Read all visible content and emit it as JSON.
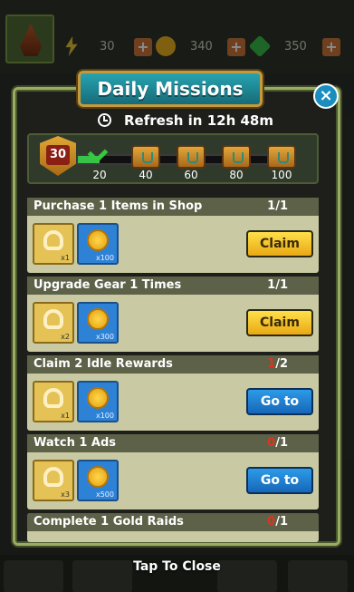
{
  "hud": {
    "energy": "30",
    "coins": "340",
    "gems": "350"
  },
  "modal": {
    "title": "Daily Missions",
    "refresh": "Refresh in 12h 48m",
    "level": "30",
    "progress_fraction": 0.1,
    "milestones": [
      "20",
      "40",
      "60",
      "80",
      "100"
    ]
  },
  "missions": [
    {
      "title": "Purchase 1 Items in Shop",
      "current": "1",
      "total": "/1",
      "current_red": false,
      "scroll_qty": "x1",
      "coin_qty": "x100",
      "action": "Claim",
      "action_type": "claim"
    },
    {
      "title": "Upgrade Gear 1 Times",
      "current": "1",
      "total": "/1",
      "current_red": false,
      "scroll_qty": "x2",
      "coin_qty": "x300",
      "action": "Claim",
      "action_type": "claim"
    },
    {
      "title": "Claim 2 Idle Rewards",
      "current": "1",
      "total": "/2",
      "current_red": true,
      "scroll_qty": "x1",
      "coin_qty": "x100",
      "action": "Go to",
      "action_type": "goto"
    },
    {
      "title": "Watch 1 Ads",
      "current": "0",
      "total": "/1",
      "current_red": true,
      "scroll_qty": "x3",
      "coin_qty": "x500",
      "action": "Go to",
      "action_type": "goto"
    },
    {
      "title": "Complete 1 Gold Raids",
      "current": "0",
      "total": "/1",
      "current_red": true
    }
  ],
  "footer": {
    "tap_close": "Tap To Close"
  },
  "colors": {
    "accent_claim": "#f1c12a",
    "accent_goto": "#1f7fcf",
    "title_teal": "#1f8e9b",
    "progress_green": "#39c24a"
  }
}
